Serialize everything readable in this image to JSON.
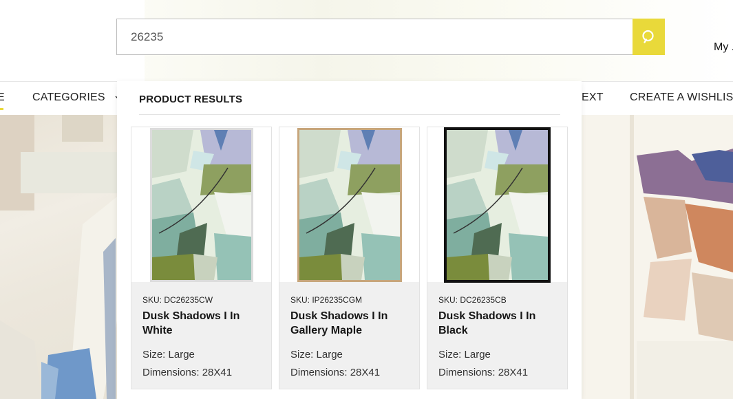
{
  "search": {
    "value": "26235",
    "icon": "search-icon"
  },
  "account": {
    "label": "My ."
  },
  "nav": {
    "partial_left": "E",
    "categories": "CATEGORIES",
    "partial_text": "EXT",
    "wishlist": "CREATE A WISHLIST"
  },
  "dropdown": {
    "title": "PRODUCT RESULTS",
    "products": [
      {
        "sku": "SKU: DC26235CW",
        "name": "Dusk Shadows I In White",
        "size": "Size: Large",
        "dimensions": "Dimensions: 28X41",
        "frame_color": "#d9d9d9"
      },
      {
        "sku": "SKU: IP26235CGM",
        "name": "Dusk Shadows I In Gallery Maple",
        "size": "Size: Large",
        "dimensions": "Dimensions: 28X41",
        "frame_color": "#c7a67c"
      },
      {
        "sku": "SKU: DC26235CB",
        "name": "Dusk Shadows I In Black",
        "size": "Size: Large",
        "dimensions": "Dimensions: 28X41",
        "frame_color": "#111111"
      }
    ]
  },
  "colors": {
    "accent": "#e9d93a",
    "card_bg": "#f0f0f0"
  }
}
